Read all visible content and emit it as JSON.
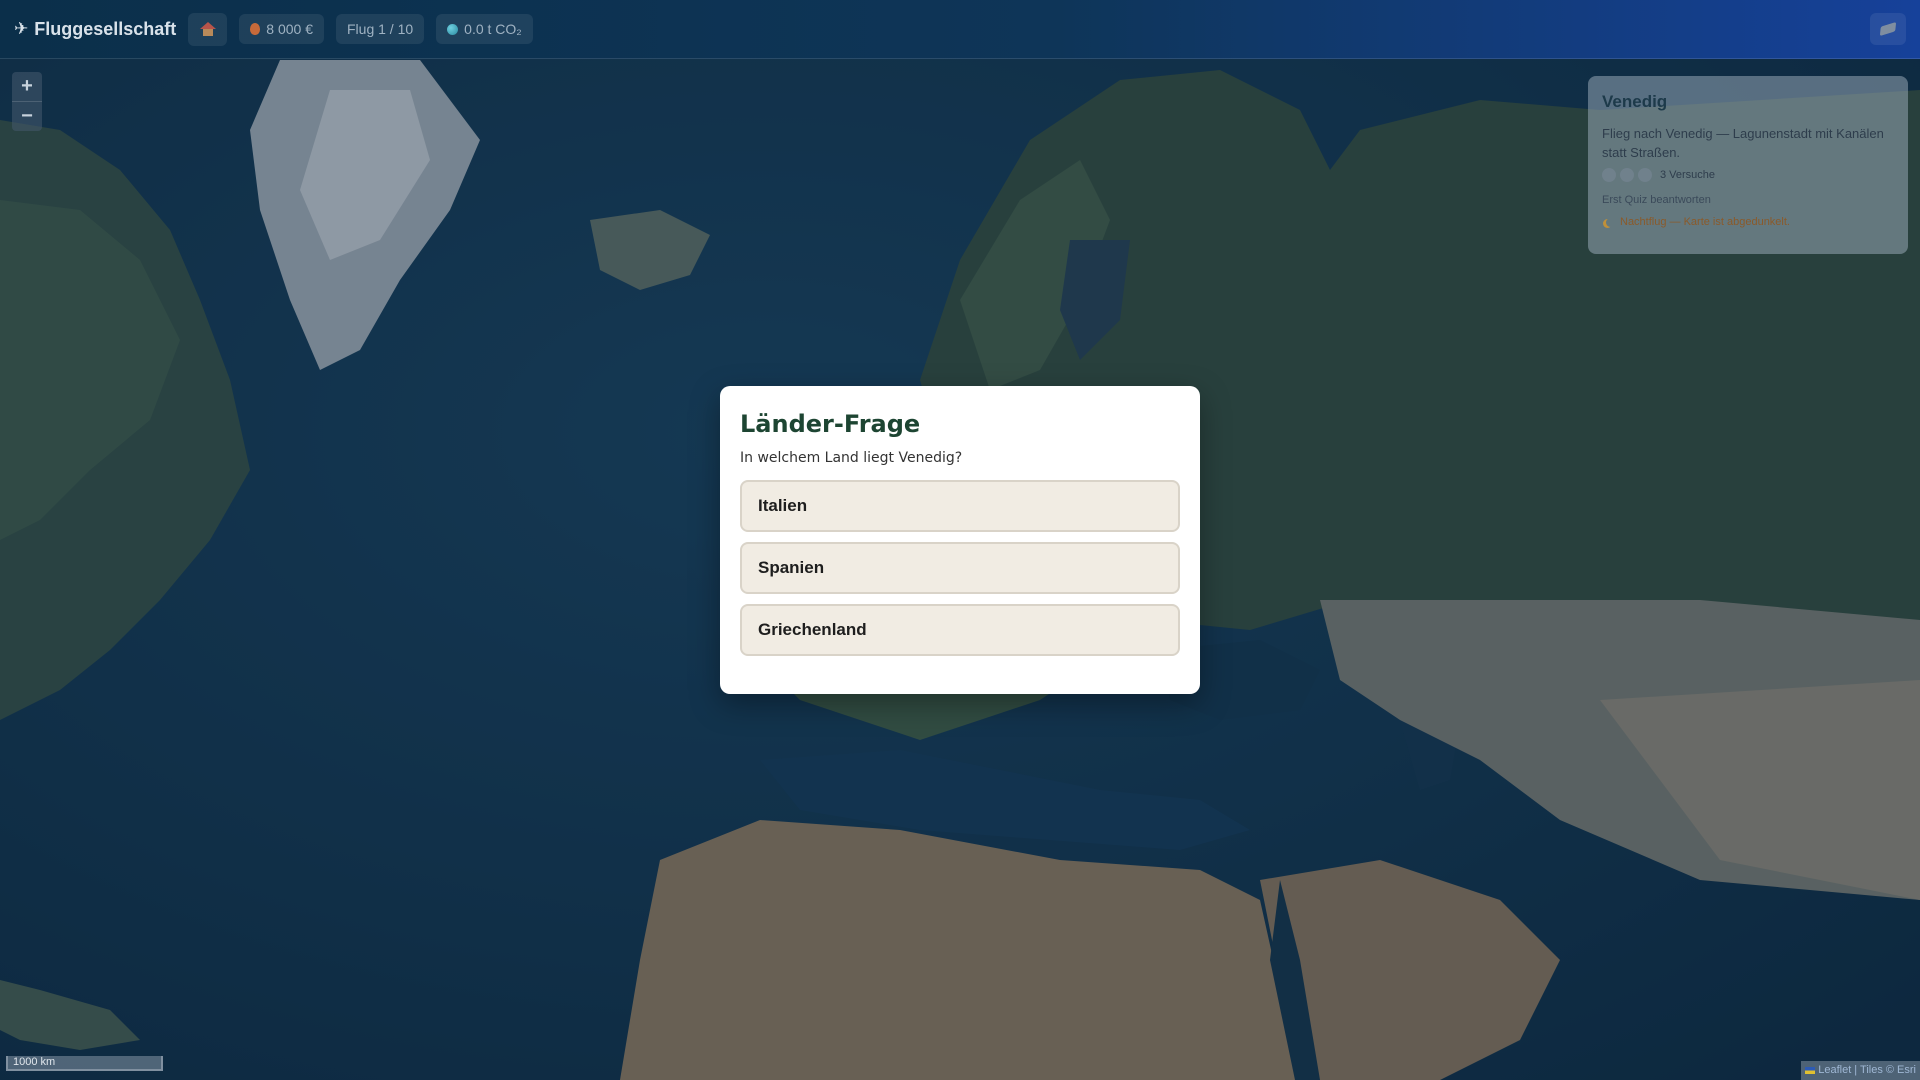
{
  "header": {
    "brand": "Fluggesellschaft",
    "money": "8 000 €",
    "flight": "Flug 1 / 10",
    "co2": "0.0 t CO₂"
  },
  "zoom": {
    "in": "+",
    "out": "−"
  },
  "mission": {
    "title": "Venedig",
    "description": "Flieg nach Venedig — Lagunenstadt mit Kanälen statt Straßen.",
    "attempts_label": "3 Versuche",
    "attempts_total": 3,
    "note": "Erst Quiz beantworten",
    "night_notice": "Nachtflug — Karte ist abgedunkelt."
  },
  "quiz": {
    "title": "Länder-Frage",
    "question": "In welchem Land liegt Venedig?",
    "answers": [
      "Italien",
      "Spanien",
      "Griechenland"
    ]
  },
  "map": {
    "scale": "1000 km",
    "attribution_link": "Leaflet",
    "attribution_rest": "| Tiles © Esri"
  },
  "colors": {
    "quiz_title": "#1d4532",
    "answer_bg": "#f1ece3",
    "night_text": "#8a5a2a"
  }
}
